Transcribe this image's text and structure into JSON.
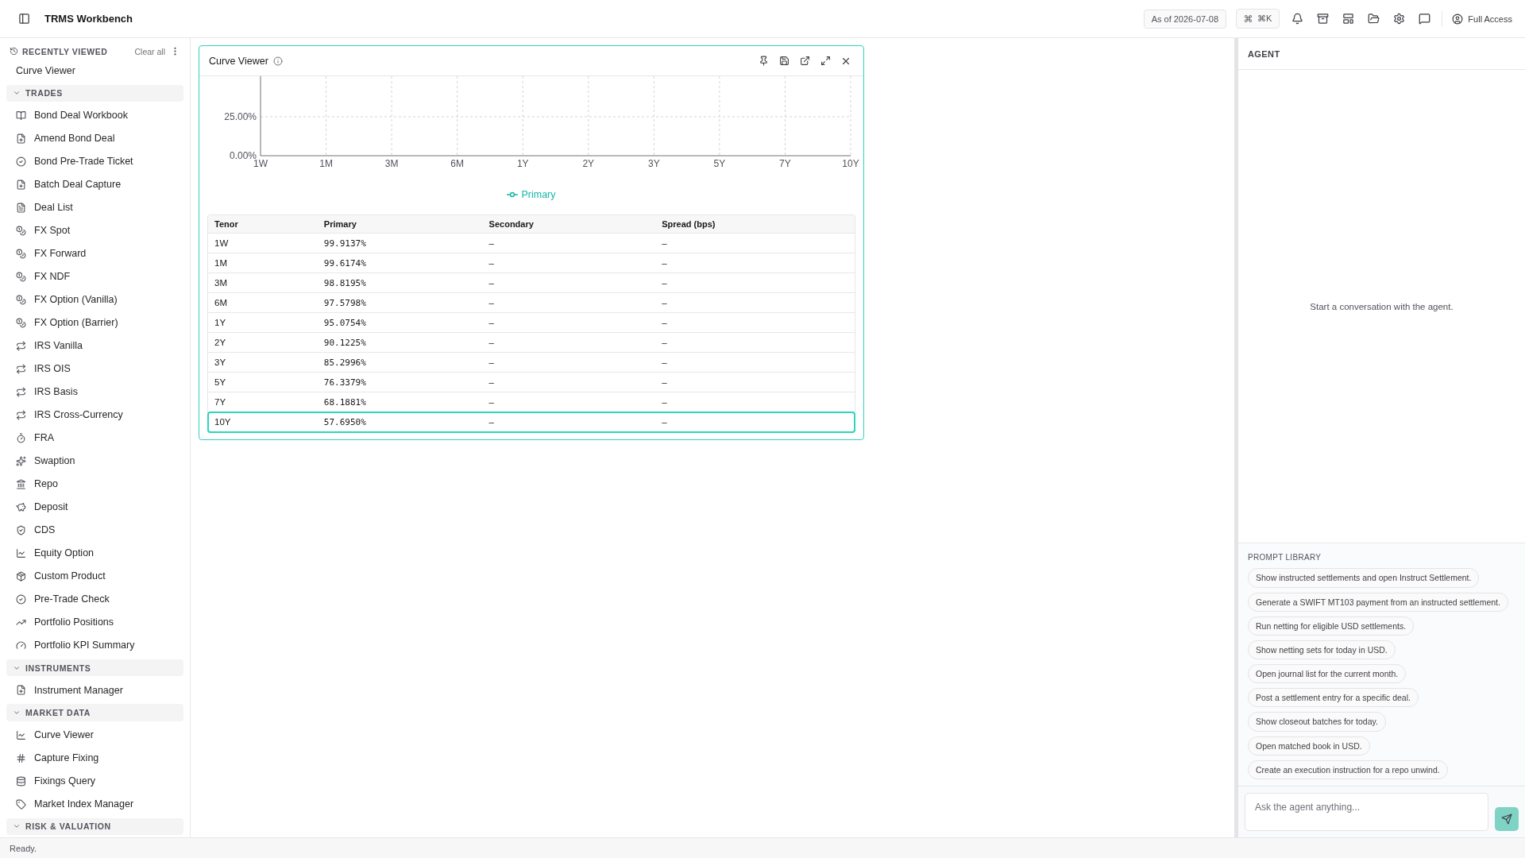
{
  "app": {
    "title": "TRMS Workbench",
    "as_of": "As of 2026-07-08",
    "shortcut": "⌘K",
    "access": "Full Access"
  },
  "sidebar": {
    "recent_title": "RECENTLY VIEWED",
    "clear": "Clear all",
    "recent": [
      "Curve Viewer"
    ],
    "sections": [
      {
        "title": "TRADES",
        "expanded": true,
        "items": [
          "Bond Deal Workbook",
          "Amend Bond Deal",
          "Bond Pre-Trade Ticket",
          "Batch Deal Capture",
          "Deal List",
          "FX Spot",
          "FX Forward",
          "FX NDF",
          "FX Option (Vanilla)",
          "FX Option (Barrier)",
          "IRS Vanilla",
          "IRS OIS",
          "IRS Basis",
          "IRS Cross-Currency",
          "FRA",
          "Swaption",
          "Repo",
          "Deposit",
          "CDS",
          "Equity Option",
          "Custom Product",
          "Pre-Trade Check",
          "Portfolio Positions",
          "Portfolio KPI Summary"
        ]
      },
      {
        "title": "INSTRUMENTS",
        "expanded": true,
        "items": [
          "Instrument Manager"
        ]
      },
      {
        "title": "MARKET DATA",
        "expanded": true,
        "items": [
          "Curve Viewer",
          "Capture Fixing",
          "Fixings Query",
          "Market Index Manager"
        ]
      },
      {
        "title": "RISK & VALUATION",
        "expanded": true
      }
    ]
  },
  "panel": {
    "title": "Curve Viewer",
    "chart_data": {
      "type": "line",
      "categories": [
        "1W",
        "1M",
        "3M",
        "6M",
        "1Y",
        "2Y",
        "3Y",
        "5Y",
        "7Y",
        "10Y"
      ],
      "series": [
        {
          "name": "Primary",
          "color": "#14b8a6",
          "values": [
            null,
            null,
            null,
            null,
            null,
            null,
            null,
            null,
            null,
            null
          ]
        }
      ],
      "ylim": [
        0,
        50
      ],
      "grid": true,
      "yticks": [
        {
          "value": 0,
          "label": "0.00%"
        },
        {
          "value": 25,
          "label": "25.00%"
        }
      ]
    },
    "table": {
      "columns": [
        "Tenor",
        "Primary",
        "Secondary",
        "Spread (bps)"
      ],
      "rows": [
        {
          "cells": [
            "1W",
            "99.9137%",
            "–",
            "–"
          ],
          "selected": false
        },
        {
          "cells": [
            "1M",
            "99.6174%",
            "–",
            "–"
          ],
          "selected": false
        },
        {
          "cells": [
            "3M",
            "98.8195%",
            "–",
            "–"
          ],
          "selected": false
        },
        {
          "cells": [
            "6M",
            "97.5798%",
            "–",
            "–"
          ],
          "selected": false
        },
        {
          "cells": [
            "1Y",
            "95.0754%",
            "–",
            "–"
          ],
          "selected": false
        },
        {
          "cells": [
            "2Y",
            "90.1225%",
            "–",
            "–"
          ],
          "selected": false
        },
        {
          "cells": [
            "3Y",
            "85.2996%",
            "–",
            "–"
          ],
          "selected": false
        },
        {
          "cells": [
            "5Y",
            "76.3379%",
            "–",
            "–"
          ],
          "selected": false
        },
        {
          "cells": [
            "7Y",
            "68.1881%",
            "–",
            "–"
          ],
          "selected": false
        },
        {
          "cells": [
            "10Y",
            "57.6950%",
            "–",
            "–"
          ],
          "selected": true
        }
      ]
    }
  },
  "agent": {
    "title": "AGENT",
    "empty": "Start a conversation with the agent.",
    "library_title": "PROMPT LIBRARY",
    "prompts": [
      "Show instructed settlements and open Instruct Settlement.",
      "Generate a SWIFT MT103 payment from an instructed settlement.",
      "Run netting for eligible USD settlements.",
      "Show netting sets for today in USD.",
      "Open journal list for the current month.",
      "Post a settlement entry for a specific deal.",
      "Show closeout batches for today.",
      "Open matched book in USD.",
      "Create an execution instruction for a repo unwind."
    ],
    "placeholder": "Ask the agent anything..."
  },
  "status_bar": "Ready."
}
